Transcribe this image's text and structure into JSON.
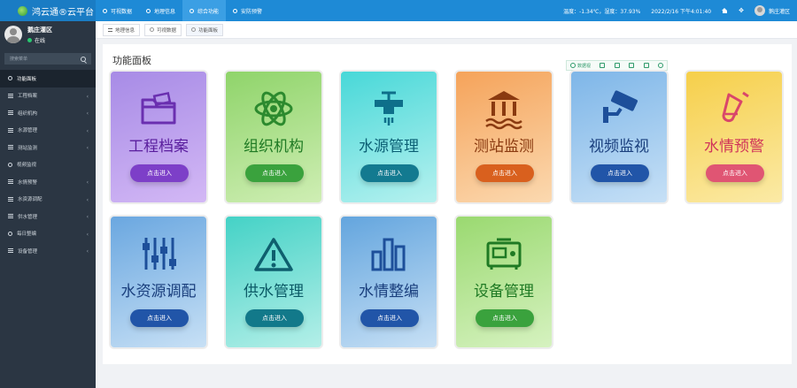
{
  "app": {
    "title": "鸿云通®云平台"
  },
  "topnav": [
    {
      "label": "可视数据"
    },
    {
      "label": "地理信息"
    },
    {
      "label": "综合功能"
    },
    {
      "label": "安防预警"
    }
  ],
  "status": {
    "weather": "温度：-1.34℃，湿度：37.93%",
    "datetime": "2022/2/16 下午4:01:40",
    "user": "鹅庄灌区"
  },
  "profile": {
    "name": "鹅庄灌区",
    "status": "在线"
  },
  "search": {
    "placeholder": "搜索菜单"
  },
  "menu": [
    {
      "label": "功能面板"
    },
    {
      "label": "工程档案"
    },
    {
      "label": "组织机构"
    },
    {
      "label": "水源管理"
    },
    {
      "label": "测站监测"
    },
    {
      "label": "视频监视"
    },
    {
      "label": "水情预警"
    },
    {
      "label": "水资源调配"
    },
    {
      "label": "供水管理"
    },
    {
      "label": "每日整编"
    },
    {
      "label": "设备管理"
    }
  ],
  "tabs": [
    {
      "label": "地理信息"
    },
    {
      "label": "可视数据"
    },
    {
      "label": "功能面板"
    }
  ],
  "panel": {
    "title": "功能面板",
    "toolbar": {
      "first_label": "数据视"
    }
  },
  "cards": [
    {
      "title": "工程档案",
      "button": "点击进入"
    },
    {
      "title": "组织机构",
      "button": "点击进入"
    },
    {
      "title": "水源管理",
      "button": "点击进入"
    },
    {
      "title": "测站监测",
      "button": "点击进入"
    },
    {
      "title": "视频监视",
      "button": "点击进入"
    },
    {
      "title": "水情预警",
      "button": "点击进入"
    },
    {
      "title": "水资源调配",
      "button": "点击进入"
    },
    {
      "title": "供水管理",
      "button": "点击进入"
    },
    {
      "title": "水情整编",
      "button": "点击进入"
    },
    {
      "title": "设备管理",
      "button": "点击进入"
    }
  ],
  "colors": {
    "topbar": "#1e8ad6",
    "sidebar": "#2b3643",
    "online": "#28c76f"
  }
}
